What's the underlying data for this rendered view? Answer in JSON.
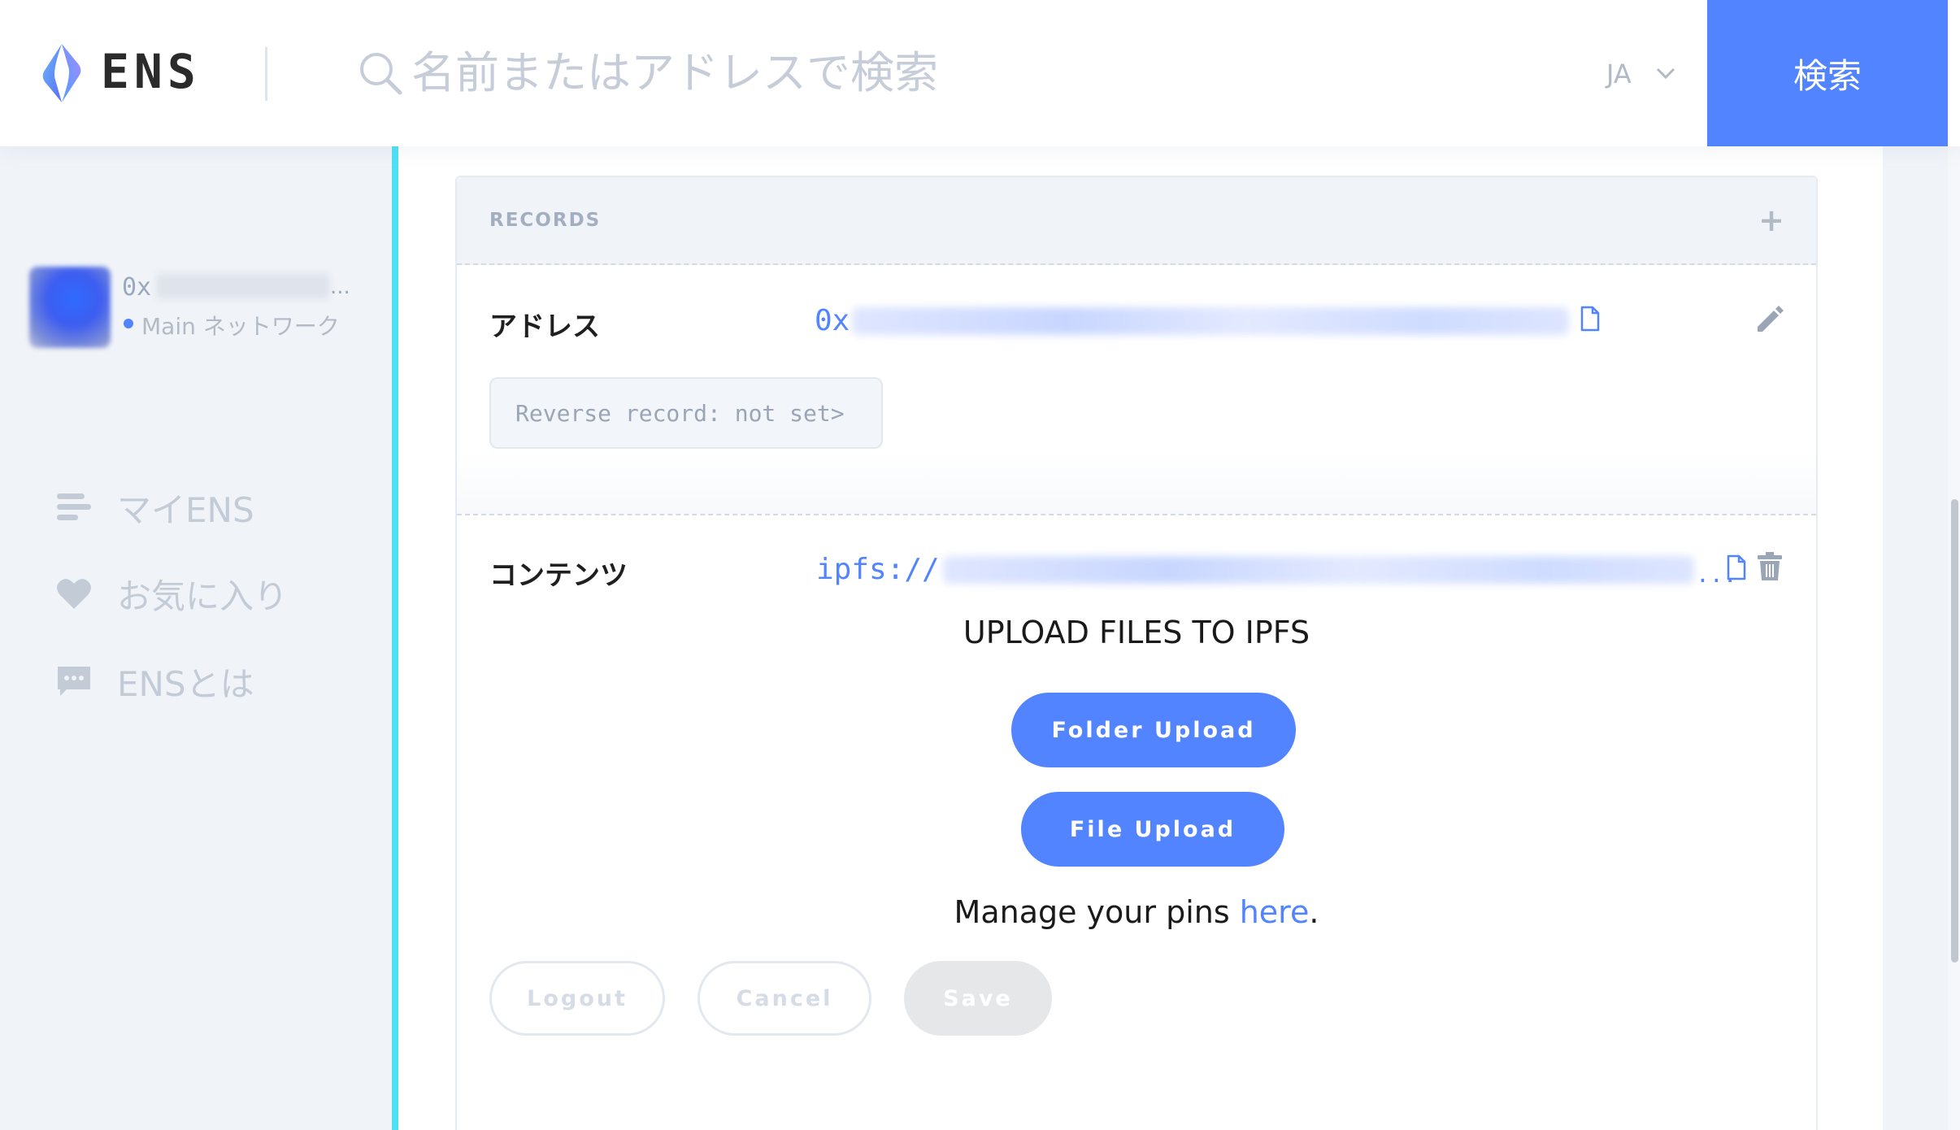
{
  "app": {
    "logo_text": "ENS",
    "brand_color": "#5284ff",
    "accent_border_color": "#4ee0f6"
  },
  "header": {
    "search_placeholder": "名前またはアドレスで検索",
    "language": "JA",
    "search_button_label": "検索"
  },
  "sidebar": {
    "account": {
      "address_prefix": "0x",
      "ellipsis": "...",
      "network": "Main ネットワーク"
    },
    "nav": [
      {
        "label": "マイENS",
        "icon": "list-icon"
      },
      {
        "label": "お気に入り",
        "icon": "heart-icon"
      },
      {
        "label": "ENSとは",
        "icon": "chat-bubble-icon"
      }
    ]
  },
  "records": {
    "title": "RECORDS",
    "add_symbol": "+",
    "address_row": {
      "label": "アドレス",
      "value_prefix": "0x",
      "reverse_record": "Reverse record: not set>"
    },
    "content_row": {
      "label": "コンテンツ",
      "value_prefix": "ipfs://",
      "ellipsis": "...",
      "upload_title": "UPLOAD FILES TO IPFS",
      "folder_upload": "Folder Upload",
      "file_upload": "File Upload",
      "manage_prefix": "Manage your pins ",
      "manage_link": "here",
      "manage_suffix": "."
    }
  },
  "actions": {
    "logout": "Logout",
    "cancel": "Cancel",
    "save": "Save"
  }
}
